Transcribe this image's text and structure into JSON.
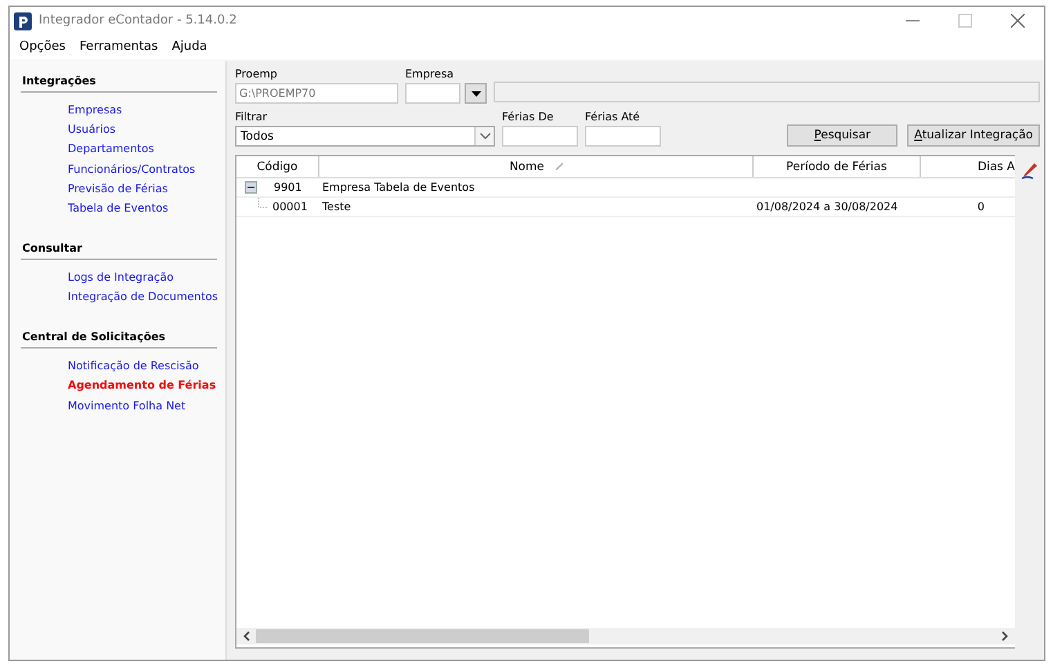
{
  "window": {
    "title": "Integrador eContador - 5.14.0.2"
  },
  "menu": [
    "Opções",
    "Ferramentas",
    "Ajuda"
  ],
  "sidebar": {
    "sections": [
      {
        "title": "Integrações",
        "items": [
          {
            "label": "Empresas",
            "selected": false
          },
          {
            "label": "Usuários",
            "selected": false
          },
          {
            "label": "Departamentos",
            "selected": false
          },
          {
            "label": "Funcionários/Contratos",
            "selected": false
          },
          {
            "label": "Previsão de Férias",
            "selected": false
          },
          {
            "label": "Tabela de Eventos",
            "selected": false
          }
        ]
      },
      {
        "title": "Consultar",
        "items": [
          {
            "label": "Logs de Integração",
            "selected": false
          },
          {
            "label": "Integração de Documentos",
            "selected": false
          }
        ]
      },
      {
        "title": "Central de Solicitações",
        "items": [
          {
            "label": "Notificação de Rescisão",
            "selected": false
          },
          {
            "label": "Agendamento de Férias",
            "selected": true
          },
          {
            "label": "Movimento Folha Net",
            "selected": false
          }
        ]
      }
    ]
  },
  "form": {
    "proemp": {
      "label": "Proemp",
      "value": "G:\\PROEMP70"
    },
    "empresa": {
      "label": "Empresa"
    },
    "filtrar": {
      "label": "Filtrar",
      "value": "Todos"
    },
    "ferias_de": {
      "label": "Férias De"
    },
    "ferias_ate": {
      "label": "Férias Até"
    }
  },
  "buttons": [
    {
      "parts": [
        {
          "text": "P",
          "underline": true
        },
        {
          "text": "esquisar",
          "underline": false
        }
      ]
    },
    {
      "parts": [
        {
          "text": "A",
          "underline": true
        },
        {
          "text": "tualizar Integração",
          "underline": false
        }
      ]
    }
  ],
  "table": {
    "columns": [
      "Código",
      "Nome",
      "Período de Férias",
      "Dias A"
    ],
    "rows": [
      {
        "cells": [
          "9901",
          "Empresa Tabela de Eventos",
          "",
          ""
        ],
        "expanded": true,
        "children": [
          {
            "cells": [
              "00001",
              "Teste",
              "01/08/2024 a 30/08/2024",
              "0"
            ]
          }
        ]
      }
    ]
  }
}
